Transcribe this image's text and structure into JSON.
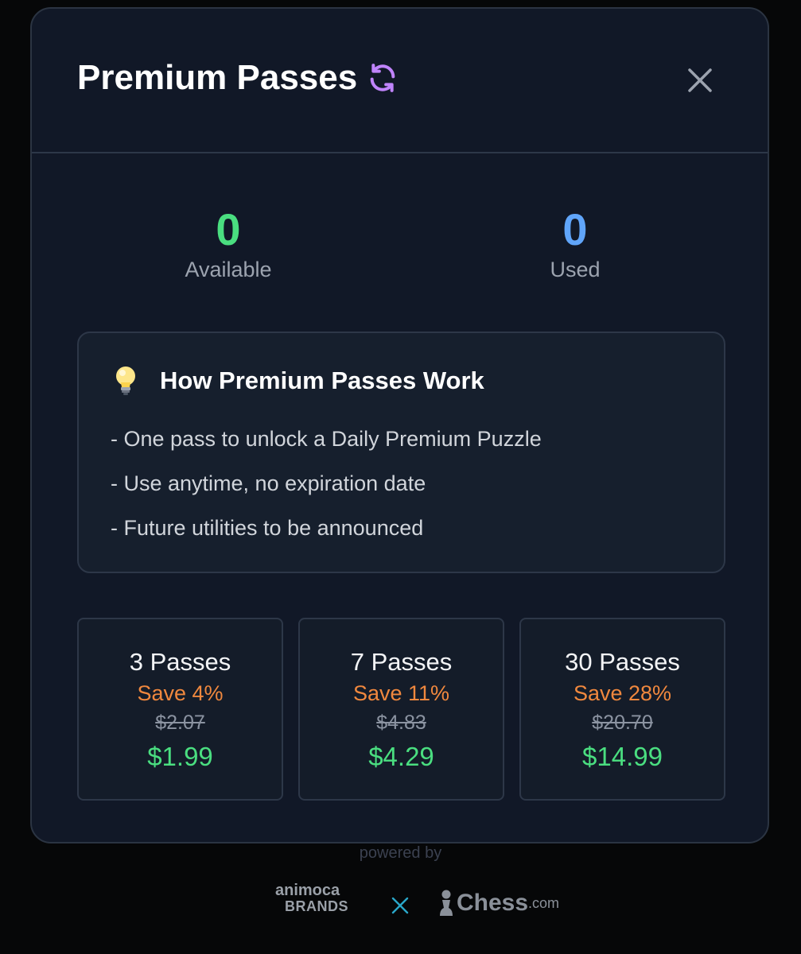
{
  "header": {
    "title": "Premium Passes",
    "refresh_icon": "refresh-icon",
    "close_icon": "close-icon"
  },
  "stats": {
    "available": {
      "value": "0",
      "label": "Available"
    },
    "used": {
      "value": "0",
      "label": "Used"
    }
  },
  "info": {
    "icon": "lightbulb-icon",
    "title": "How Premium Passes Work",
    "items": [
      "- One pass to unlock a Daily Premium Puzzle",
      "- Use anytime, no expiration date",
      "- Future utilities to be announced"
    ]
  },
  "packages": [
    {
      "name": "3 Passes",
      "save": "Save 4%",
      "original_price": "$2.07",
      "price": "$1.99"
    },
    {
      "name": "7 Passes",
      "save": "Save 11%",
      "original_price": "$4.83",
      "price": "$4.29"
    },
    {
      "name": "30 Passes",
      "save": "Save 28%",
      "original_price": "$20.70",
      "price": "$14.99"
    }
  ],
  "footer": {
    "powered_by": "powered by",
    "brand1_line1": "animoca",
    "brand1_line2": "BRANDS",
    "brand2_name": "Chess",
    "brand2_suffix": ".com"
  },
  "colors": {
    "background": "#060708",
    "modal": "#111827",
    "available": "#4ade80",
    "used": "#60a5fa",
    "save": "#f0883e",
    "price": "#4ade80",
    "refresh_icon": "#c084fc"
  }
}
